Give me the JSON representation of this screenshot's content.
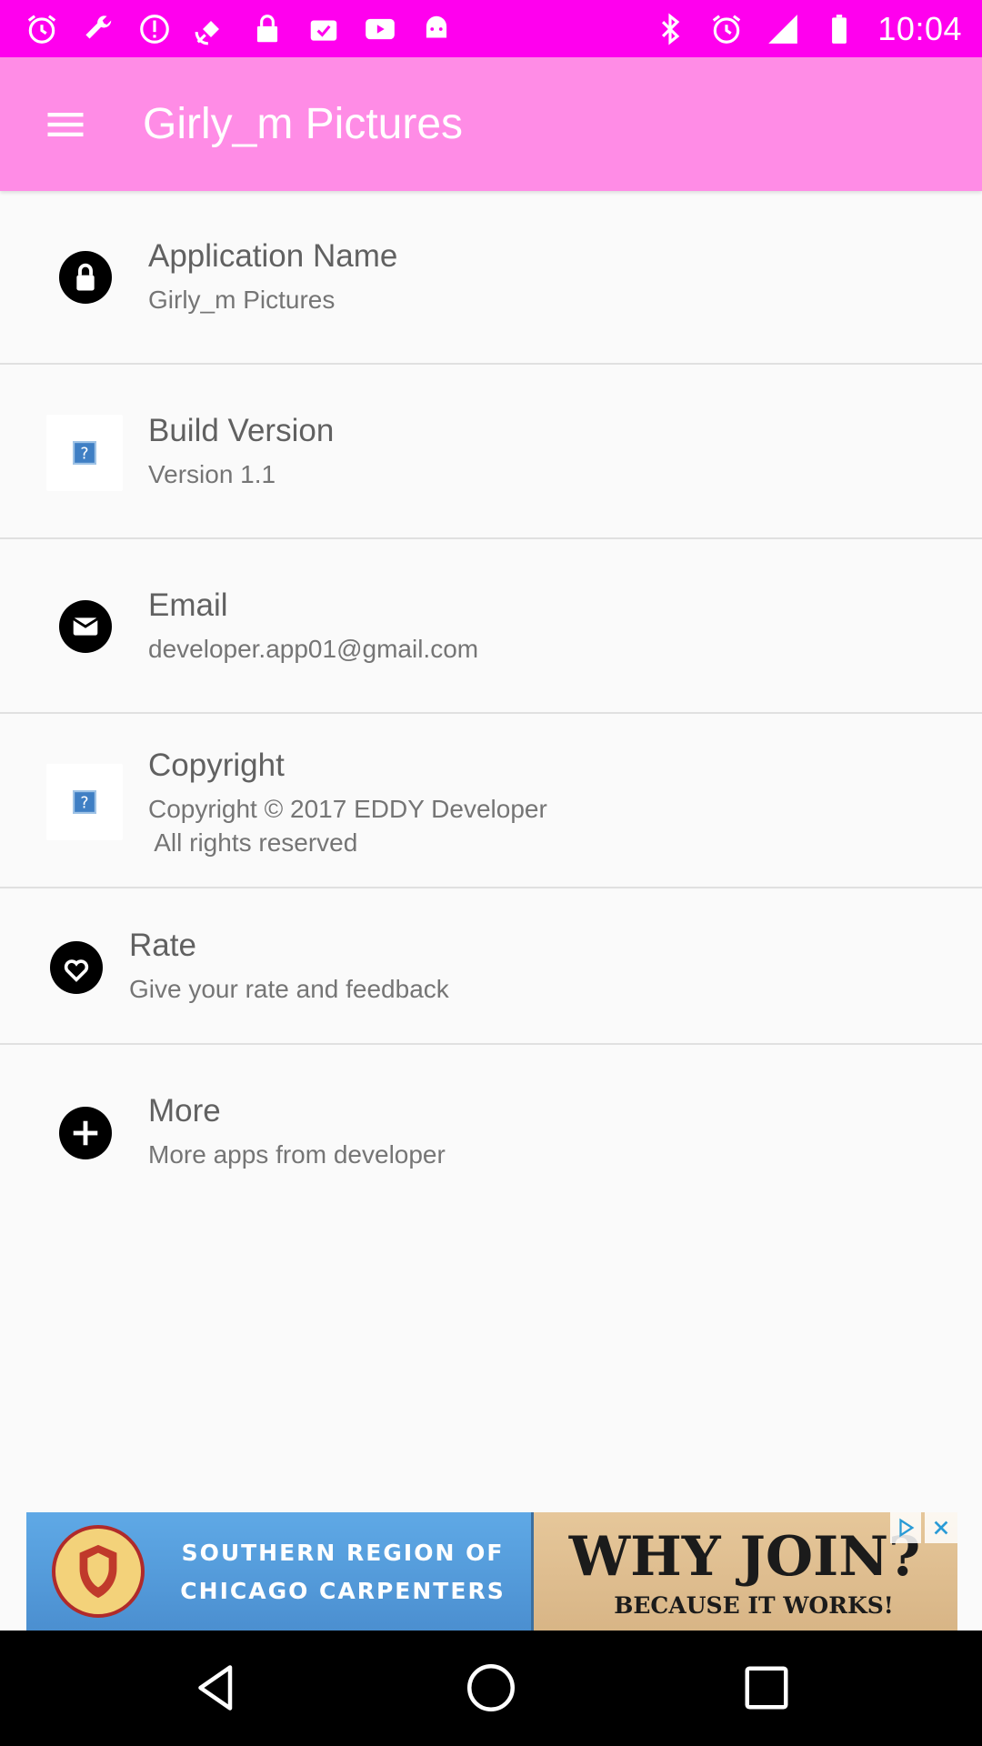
{
  "status_bar": {
    "time": "10:04",
    "left_icons": [
      "alarm-icon",
      "wrench-icon",
      "info-alert-icon",
      "satellite-icon",
      "lock-icon",
      "task-icon",
      "youtube-icon",
      "android-icon"
    ],
    "right_icons": [
      "bluetooth-icon",
      "alarm-icon",
      "signal-icon",
      "battery-icon"
    ],
    "color": "#ff00ee"
  },
  "app_bar": {
    "title": "Girly_m Pictures",
    "menu_icon": "hamburger-menu-icon",
    "color": "#ff8ce6"
  },
  "list": {
    "items": [
      {
        "title": "Application Name",
        "subtitle": "Girly_m Pictures",
        "icon": "lock-circle-icon"
      },
      {
        "title": "Build Version",
        "subtitle": "Version 1.1",
        "icon": "missing-image-icon"
      },
      {
        "title": "Email",
        "subtitle": "developer.app01@gmail.com",
        "icon": "mail-circle-icon"
      },
      {
        "title": "Copyright",
        "subtitle": "Copyright © 2017 EDDY Developer\n All rights reserved",
        "icon": "missing-image-icon"
      },
      {
        "title": "Rate",
        "subtitle": "Give your rate and feedback",
        "icon": "heart-circle-icon"
      },
      {
        "title": "More",
        "subtitle": "More apps from developer",
        "icon": "plus-circle-icon"
      }
    ]
  },
  "ad": {
    "line1": "SOUTHERN REGION OF",
    "line2": "CHICAGO CARPENTERS",
    "headline": "WHY JOIN?",
    "tagline": "BECAUSE IT WORKS!"
  },
  "nav_bar": {
    "buttons": [
      "back-icon",
      "home-icon",
      "recents-icon"
    ]
  }
}
